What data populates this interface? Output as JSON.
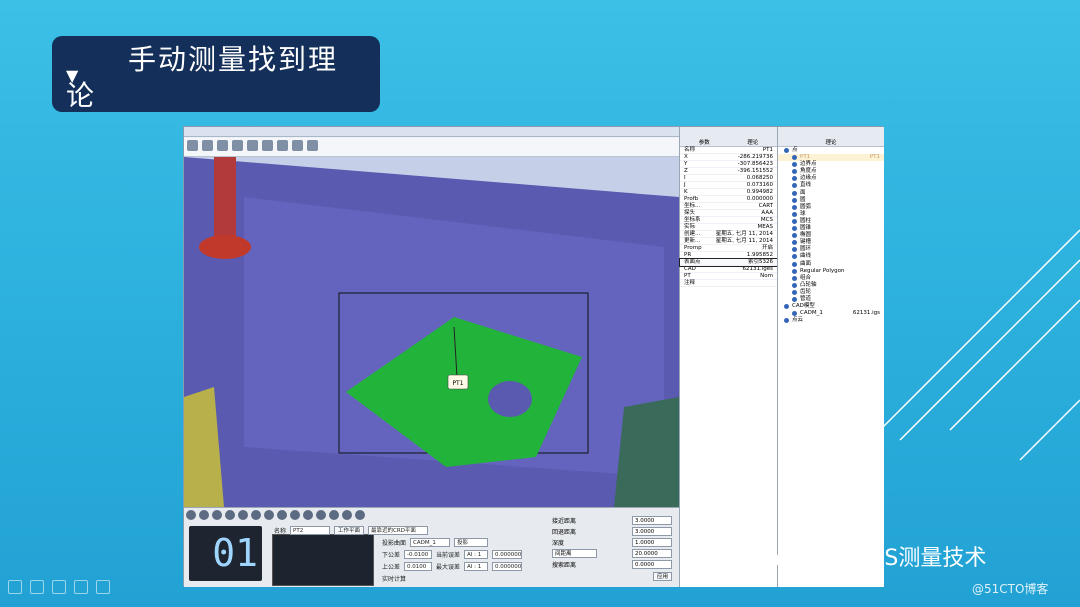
{
  "slide": {
    "title_line1": "手动测量找到理",
    "title_line2": "论",
    "watermark_text": "RationalDMIS测量技术",
    "credit": "@51CTO博客",
    "colors": {
      "title_bg": "#14305a",
      "bg_top": "#3cc0e6",
      "bg_bottom": "#22a2d4"
    }
  },
  "viewport": {
    "point_label": "PT1"
  },
  "bottom": {
    "counter": "01",
    "name_label": "名称",
    "name_value": "PT2",
    "workplane_btn": "工作平面",
    "plane_select": "最靠近的CRD平面",
    "cad_label": "投影曲面",
    "cad_value": "CADM_1",
    "projection": "投影",
    "lower_tol_label": "下公差",
    "lower_tol": "-0.0100",
    "upper_tol_label": "上公差",
    "upper_tol": "0.0100",
    "current_label": "当前误差",
    "max_label": "最大误差",
    "ai_1": "AI : 1",
    "ai_val": "0.000000",
    "realtime": "实时计算",
    "approach_label": "接近距离",
    "approach": "3.0000",
    "retract_label": "回退距离",
    "retract": "3.0000",
    "depth_label": "深度",
    "depth": "1.0000",
    "spacing_select": "间距离",
    "spacing": "20.0000",
    "search_label": "搜索距离",
    "search": "0.0000",
    "apply": "应用"
  },
  "props": {
    "col1": "参数",
    "col2": "理论",
    "rows": [
      [
        "名称",
        "PT1"
      ],
      [
        "X",
        "-286.219736"
      ],
      [
        "Y",
        "-307.856423"
      ],
      [
        "Z",
        "-396.151552"
      ],
      [
        "I",
        "0.068250"
      ],
      [
        "J",
        "0.073160"
      ],
      [
        "K",
        "0.994982"
      ],
      [
        "Profb",
        "0.000000"
      ],
      [
        "坐标...",
        "CART"
      ],
      [
        "探头",
        "AAA"
      ],
      [
        "坐标系",
        "MCS"
      ],
      [
        "实际",
        "MEAS"
      ],
      [
        "创建...",
        "星期五, 七月 11, 2014"
      ],
      [
        "更新...",
        "星期五, 七月 11, 2014"
      ],
      [
        "Promp",
        "开启"
      ],
      [
        "PR",
        "1.995852"
      ],
      [
        "表面点",
        "索引5326"
      ],
      [
        "CAD",
        "62131.iges"
      ],
      [
        "PT",
        "Nom"
      ],
      [
        "注释",
        ""
      ]
    ]
  },
  "tree": {
    "head": "理论",
    "rows": [
      {
        "label": "点",
        "sub": false,
        "sel": false
      },
      {
        "label": "PT1",
        "sub": true,
        "sel": true,
        "right": "PT1"
      },
      {
        "label": "边界点",
        "sub": true,
        "sel": false
      },
      {
        "label": "角度点",
        "sub": true,
        "sel": false
      },
      {
        "label": "边缘点",
        "sub": true,
        "sel": false
      },
      {
        "label": "直线",
        "sub": true,
        "sel": false
      },
      {
        "label": "面",
        "sub": true,
        "sel": false
      },
      {
        "label": "圆",
        "sub": true,
        "sel": false
      },
      {
        "label": "圆弧",
        "sub": true,
        "sel": false
      },
      {
        "label": "球",
        "sub": true,
        "sel": false
      },
      {
        "label": "圆柱",
        "sub": true,
        "sel": false
      },
      {
        "label": "圆锥",
        "sub": true,
        "sel": false
      },
      {
        "label": "椭圆",
        "sub": true,
        "sel": false
      },
      {
        "label": "键槽",
        "sub": true,
        "sel": false
      },
      {
        "label": "圆环",
        "sub": true,
        "sel": false
      },
      {
        "label": "曲线",
        "sub": true,
        "sel": false
      },
      {
        "label": "曲面",
        "sub": true,
        "sel": false
      },
      {
        "label": "Regular Polygon",
        "sub": true,
        "sel": false
      },
      {
        "label": "组合",
        "sub": true,
        "sel": false
      },
      {
        "label": "凸轮轴",
        "sub": true,
        "sel": false
      },
      {
        "label": "齿轮",
        "sub": true,
        "sel": false
      },
      {
        "label": "管道",
        "sub": true,
        "sel": false
      },
      {
        "label": "CAD模型",
        "sub": false,
        "sel": false
      },
      {
        "label": "CADM_1",
        "sub": true,
        "sel": false,
        "right": "62131.igs"
      },
      {
        "label": "点云",
        "sub": false,
        "sel": false
      }
    ]
  }
}
